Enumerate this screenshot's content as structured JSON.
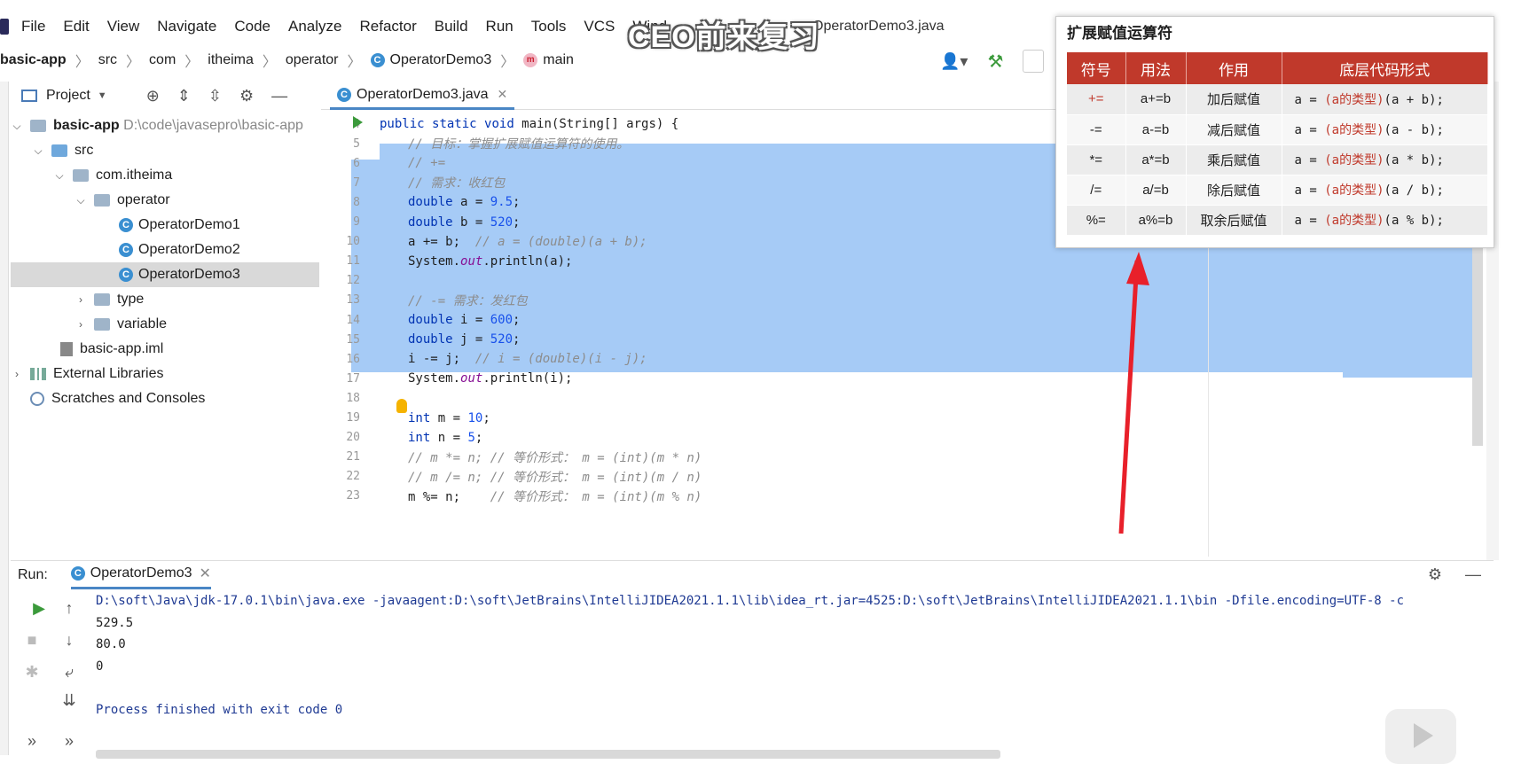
{
  "menu": {
    "items": [
      "File",
      "Edit",
      "View",
      "Navigate",
      "Code",
      "Analyze",
      "Refactor",
      "Build",
      "Run",
      "Tools",
      "VCS",
      "Wind"
    ],
    "window_title": "OperatorDemo3.java"
  },
  "caption": "CEO前来复习",
  "breadcrumb": {
    "project": "basic-app",
    "parts": [
      "src",
      "com",
      "itheima",
      "operator"
    ],
    "class": "OperatorDemo3",
    "method": "main"
  },
  "project_panel": {
    "title": "Project",
    "root": "basic-app",
    "root_path": "D:\\code\\javasepro\\basic-app",
    "src": "src",
    "pkg": "com.itheima",
    "operator": "operator",
    "files": [
      "OperatorDemo1",
      "OperatorDemo2",
      "OperatorDemo3"
    ],
    "type": "type",
    "variable": "variable",
    "iml": "basic-app.iml",
    "ext_libs": "External Libraries",
    "scratches": "Scratches and Consoles"
  },
  "editor": {
    "tab": "OperatorDemo3.java",
    "lines": [
      {
        "n": "4",
        "code": "public static void main(String[] args) {"
      },
      {
        "n": "5",
        "code": "// 目标：掌握扩展赋值运算符的使用。"
      },
      {
        "n": "6",
        "code": "// +="
      },
      {
        "n": "7",
        "code": "// 需求：收红包"
      },
      {
        "n": "8",
        "code": "double a = 9.5;"
      },
      {
        "n": "9",
        "code": "double b = 520;"
      },
      {
        "n": "10",
        "code": "a += b;  // a = (double)(a + b);"
      },
      {
        "n": "11",
        "code": "System.out.println(a);"
      },
      {
        "n": "12",
        "code": ""
      },
      {
        "n": "13",
        "code": "// -= 需求：发红包"
      },
      {
        "n": "14",
        "code": "double i = 600;"
      },
      {
        "n": "15",
        "code": "double j = 520;"
      },
      {
        "n": "16",
        "code": "i -= j;  // i = (double)(i - j);"
      },
      {
        "n": "17",
        "code": "System.out.println(i);"
      },
      {
        "n": "18",
        "code": ""
      },
      {
        "n": "19",
        "code": "int m = 10;"
      },
      {
        "n": "20",
        "code": "int n = 5;"
      },
      {
        "n": "21",
        "code": "// m *= n; // 等价形式： m = (int)(m * n)"
      },
      {
        "n": "22",
        "code": "// m /= n; // 等价形式： m = (int)(m / n)"
      },
      {
        "n": "23",
        "code": "m %= n;    // 等价形式： m = (int)(m % n)"
      }
    ]
  },
  "ref_table": {
    "title": "扩展赋值运算符",
    "headers": [
      "符号",
      "用法",
      "作用",
      "底层代码形式"
    ],
    "rows": [
      {
        "sym": "+=",
        "usage": "a+=b",
        "effect": "加后赋值",
        "pre": "a = ",
        "cast": "(a的类型)",
        "post": "(a + b);"
      },
      {
        "sym": "-=",
        "usage": "a-=b",
        "effect": "减后赋值",
        "pre": "a = ",
        "cast": "(a的类型)",
        "post": "(a - b);"
      },
      {
        "sym": "*=",
        "usage": "a*=b",
        "effect": "乘后赋值",
        "pre": "a = ",
        "cast": "(a的类型)",
        "post": "(a * b);"
      },
      {
        "sym": "/=",
        "usage": "a/=b",
        "effect": "除后赋值",
        "pre": "a = ",
        "cast": "(a的类型)",
        "post": "(a / b);"
      },
      {
        "sym": "%=",
        "usage": "a%=b",
        "effect": "取余后赋值",
        "pre": "a = ",
        "cast": "(a的类型)",
        "post": "(a % b);"
      }
    ]
  },
  "run_panel": {
    "label": "Run:",
    "tab": "OperatorDemo3",
    "output": [
      "D:\\soft\\Java\\jdk-17.0.1\\bin\\java.exe -javaagent:D:\\soft\\JetBrains\\IntelliJIDEA2021.1.1\\lib\\idea_rt.jar=4525:D:\\soft\\JetBrains\\IntelliJIDEA2021.1.1\\bin -Dfile.encoding=UTF-8 -c",
      "529.5",
      "80.0",
      "0",
      "",
      "Process finished with exit code 0"
    ]
  },
  "colors": {
    "accent_red": "#c0392b",
    "selection": "#a6cbf6"
  }
}
